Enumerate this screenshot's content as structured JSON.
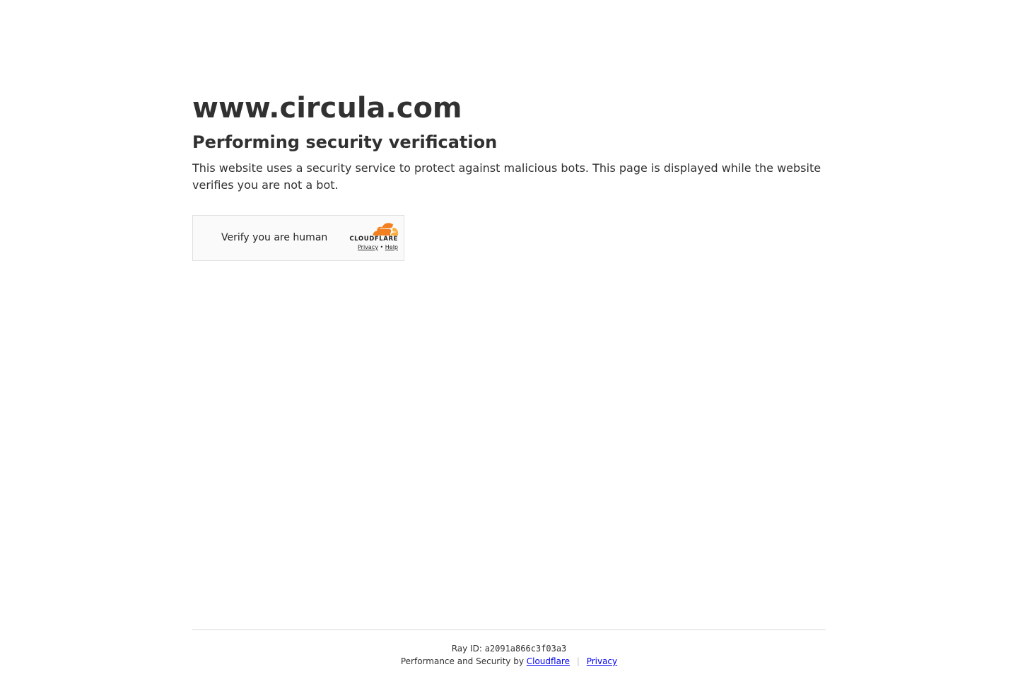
{
  "header": {
    "site_title": "www.circula.com",
    "subtitle": "Performing security verification",
    "description": "This website uses a security service to protect against malicious bots. This page is displayed while the website verifies you are not a bot."
  },
  "widget": {
    "label": "Verify you are human",
    "brand_name": "CLOUDFLARE",
    "privacy_link": "Privacy",
    "bullet": "•",
    "help_link": "Help",
    "logo_icon": "cloudflare-cloud-icon"
  },
  "footer": {
    "ray_label": "Ray ID:",
    "ray_id": "a2091a866c3f03a3",
    "performance_text": "Performance and Security by",
    "cloudflare_link": "Cloudflare",
    "separator": "|",
    "privacy_link": "Privacy"
  },
  "colors": {
    "text": "#313131",
    "link": "#0000ee",
    "cloudflare_orange": "#f38020",
    "cloudflare_light_orange": "#faae40"
  }
}
